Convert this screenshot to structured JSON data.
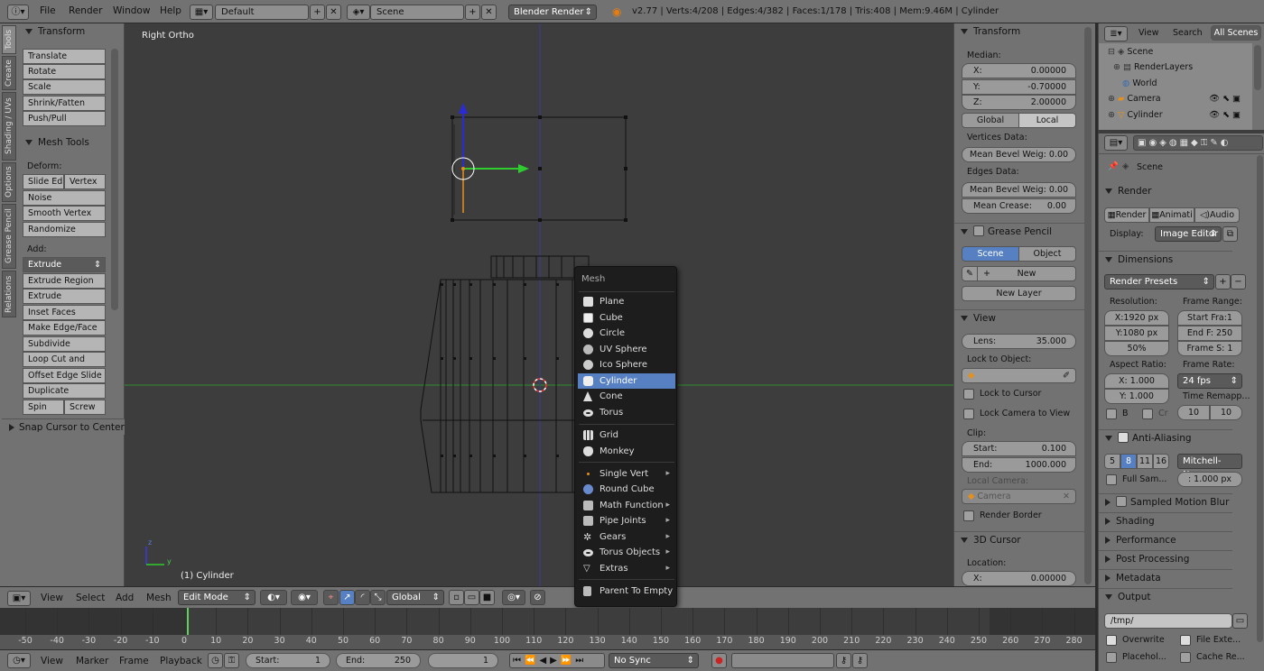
{
  "topbar": {
    "menus": [
      "File",
      "Render",
      "Window",
      "Help"
    ],
    "layout": "Default",
    "scene": "Scene",
    "engine": "Blender Render",
    "stats": "v2.77 | Verts:4/208 | Edges:4/382 | Faces:1/178 | Tris:408 | Mem:9.46M | Cylinder"
  },
  "sidetabs": [
    "Tools",
    "Create",
    "Shading / UVs",
    "Options",
    "Grease Pencil",
    "Relations"
  ],
  "toolshelf": {
    "transform_header": "Transform",
    "transform": [
      "Translate",
      "Rotate",
      "Scale",
      "Shrink/Fatten",
      "Push/Pull"
    ],
    "meshtools_header": "Mesh Tools",
    "deform_label": "Deform:",
    "slide_edge": "Slide Ed",
    "vertex": "Vertex",
    "deform": [
      "Noise",
      "Smooth Vertex",
      "Randomize"
    ],
    "add_label": "Add:",
    "extrude": "Extrude",
    "add": [
      "Extrude Region",
      "Extrude Individual",
      "Inset Faces",
      "Make Edge/Face",
      "Subdivide",
      "Loop Cut and Slide",
      "Offset Edge Slide",
      "Duplicate"
    ],
    "spin": "Spin",
    "screw": "Screw",
    "snap": "Snap Cursor to Center"
  },
  "viewport": {
    "view_label": "Right Ortho",
    "object_label": "(1) Cylinder",
    "axis_z": "z",
    "axis_y": "y"
  },
  "viewport_header": {
    "menus": [
      "View",
      "Select",
      "Add",
      "Mesh"
    ],
    "mode": "Edit Mode",
    "orientation": "Global"
  },
  "mesh_menu": {
    "title": "Mesh",
    "items": [
      {
        "label": "Plane",
        "icon": "plane-icon",
        "submenu": false
      },
      {
        "label": "Cube",
        "icon": "cube-icon",
        "submenu": false
      },
      {
        "label": "Circle",
        "icon": "circle-icon",
        "submenu": false
      },
      {
        "label": "UV Sphere",
        "icon": "uv-sphere-icon",
        "submenu": false
      },
      {
        "label": "Ico Sphere",
        "icon": "ico-sphere-icon",
        "submenu": false
      },
      {
        "label": "Cylinder",
        "icon": "cylinder-icon",
        "submenu": false,
        "active": true
      },
      {
        "label": "Cone",
        "icon": "cone-icon",
        "submenu": false
      },
      {
        "label": "Torus",
        "icon": "torus-icon",
        "submenu": false
      }
    ],
    "items2": [
      {
        "label": "Grid",
        "icon": "grid-icon"
      },
      {
        "label": "Monkey",
        "icon": "monkey-icon"
      }
    ],
    "items3": [
      {
        "label": "Single Vert",
        "icon": "vert-icon"
      },
      {
        "label": "Round Cube",
        "icon": "round-cube-icon"
      },
      {
        "label": "Math Function",
        "icon": "math-icon"
      },
      {
        "label": "Pipe Joints",
        "icon": "pipe-icon"
      },
      {
        "label": "Gears",
        "icon": "gear-icon"
      },
      {
        "label": "Torus Objects",
        "icon": "torus-objects-icon"
      },
      {
        "label": "Extras",
        "icon": "extras-icon"
      }
    ],
    "parent": "Parent To Empty"
  },
  "npanel": {
    "transform_header": "Transform",
    "median_label": "Median:",
    "median": [
      {
        "k": "X:",
        "v": "0.00000"
      },
      {
        "k": "Y:",
        "v": "-0.70000"
      },
      {
        "k": "Z:",
        "v": "2.00000"
      }
    ],
    "global": "Global",
    "local": "Local",
    "vertices_data": "Vertices Data:",
    "mean_bevel_v": "Mean Bevel Weig: 0.00",
    "edges_data": "Edges Data:",
    "mean_bevel_e": "Mean Bevel Weig: 0.00",
    "mean_crease_k": "Mean Crease:",
    "mean_crease_v": "0.00",
    "grease_header": "Grease Pencil",
    "scene_tab": "Scene",
    "object_tab": "Object",
    "new": "New",
    "new_layer": "New Layer",
    "view_header": "View",
    "lens_k": "Lens:",
    "lens_v": "35.000",
    "lock_object": "Lock to Object:",
    "lock_cursor": "Lock to Cursor",
    "lock_camera": "Lock Camera to View",
    "clip": "Clip:",
    "clip_start_k": "Start:",
    "clip_start_v": "0.100",
    "clip_end_k": "End:",
    "clip_end_v": "1000.000",
    "local_camera": "Local Camera:",
    "camera": "Camera",
    "render_border": "Render Border",
    "cursor_header": "3D Cursor",
    "location": "Location:",
    "loc_x_k": "X:",
    "loc_x_v": "0.00000"
  },
  "outliner": {
    "view": "View",
    "search": "Search",
    "all_scenes": "All Scenes",
    "rows": [
      "Scene",
      "RenderLayers",
      "World",
      "Camera",
      "Cylinder"
    ]
  },
  "props": {
    "scene_label": "Scene",
    "render_header": "Render",
    "render_btn": "Render",
    "anim_btn": "Animati",
    "audio_btn": "Audio",
    "display_label": "Display:",
    "display_value": "Image Editor",
    "dimensions_header": "Dimensions",
    "presets": "Render Presets",
    "resolution": "Resolution:",
    "frame_range": "Frame Range:",
    "res_x": "X:1920 px",
    "res_y": "Y:1080 px",
    "res_pct": "50%",
    "start_frame": "Start Fra:1",
    "end_frame": "End F: 250",
    "frame_step": "Frame S: 1",
    "aspect": "Aspect Ratio:",
    "frame_rate": "Frame Rate:",
    "asp_x": "X:   1.000",
    "asp_y": "Y:   1.000",
    "fps": "24 fps",
    "time_remap": "Time Remapp...",
    "b": "B",
    "cr": "Cr",
    "remap_old": "10",
    "remap_new": "10",
    "aa_header": "Anti-Aliasing",
    "aa_vals": [
      "5",
      "8",
      "11",
      "16"
    ],
    "aa_filter": "Mitchell-Ne...",
    "full_sample": "Full Sam...",
    "filter_size": ": 1.000 px",
    "motion_blur": "Sampled Motion Blur",
    "shading": "Shading",
    "performance": "Performance",
    "post": "Post Processing",
    "metadata": "Metadata",
    "output": "Output",
    "path": "/tmp/",
    "overwrite": "Overwrite",
    "file_ext": "File Exte...",
    "placeholders": "Placehol...",
    "cache": "Cache Re..."
  },
  "timeline": {
    "ticks": [
      "-50",
      "-40",
      "-30",
      "-20",
      "-10",
      "0",
      "10",
      "20",
      "30",
      "40",
      "50",
      "60",
      "70",
      "80",
      "90",
      "100",
      "110",
      "120",
      "130",
      "140",
      "150",
      "160",
      "170",
      "180",
      "190",
      "200",
      "210",
      "220",
      "230",
      "240",
      "250",
      "260",
      "270",
      "280"
    ],
    "current_frame": 1
  },
  "tlhead": {
    "menus": [
      "View",
      "Marker",
      "Frame",
      "Playback"
    ],
    "start_k": "Start:",
    "start_v": "1",
    "end_k": "End:",
    "end_v": "250",
    "current": "1",
    "sync": "No Sync"
  },
  "colors": {
    "accent": "#5680c2",
    "panel": "#727272",
    "viewport": "#3d3d3d"
  }
}
